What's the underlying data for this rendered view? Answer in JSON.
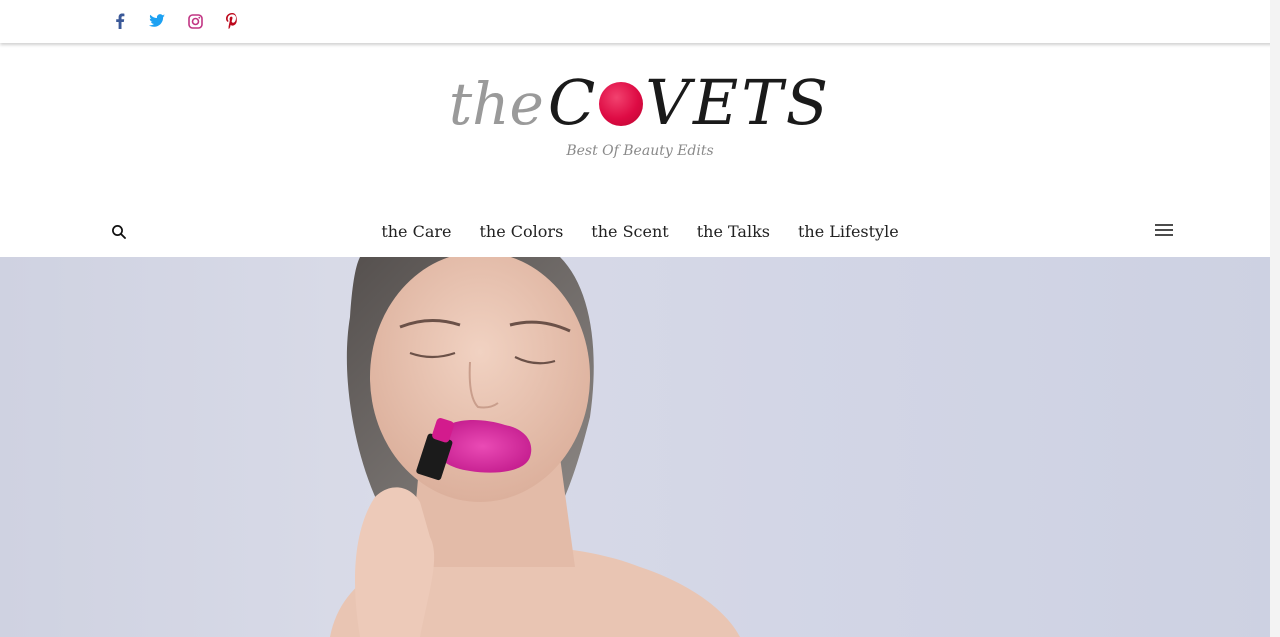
{
  "social": {
    "items": [
      {
        "name": "facebook",
        "icon": "facebook-icon",
        "color": "#3b5998"
      },
      {
        "name": "twitter",
        "icon": "twitter-icon",
        "color": "#1da1f2"
      },
      {
        "name": "instagram",
        "icon": "instagram-icon",
        "color": "#c13584"
      },
      {
        "name": "pinterest",
        "icon": "pinterest-icon",
        "color": "#bd081c"
      }
    ]
  },
  "logo": {
    "prefix": "the",
    "first_letter": "C",
    "rest": "VETS",
    "accent_color": "#de0b44"
  },
  "tagline": "Best Of Beauty Edits",
  "nav": {
    "items": [
      {
        "label": "the Care"
      },
      {
        "label": "the Colors"
      },
      {
        "label": "the Scent"
      },
      {
        "label": "the Talks"
      },
      {
        "label": "the Lifestyle"
      }
    ],
    "search_icon": "search-icon",
    "menu_icon": "hamburger-menu-icon"
  },
  "hero": {
    "image": "woman-applying-pink-lipstick-photo"
  }
}
